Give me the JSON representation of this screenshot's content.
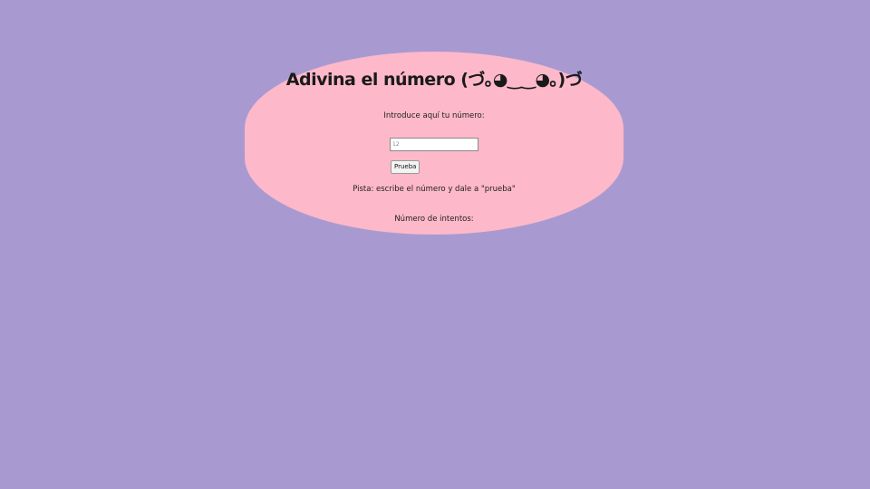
{
  "page": {
    "background_color": "#a89ad1",
    "card_color": "#fdb8c9"
  },
  "game": {
    "title": "Adivina el número (づ｡◕‿‿◕｡)づ",
    "prompt": "Introduce aquí tu número:",
    "input": {
      "value": "",
      "placeholder": "12"
    },
    "button_label": "Prueba",
    "hint": "Pista: escribe el número y dale a \"prueba\"",
    "attempts_label": "Número de intentos:"
  }
}
